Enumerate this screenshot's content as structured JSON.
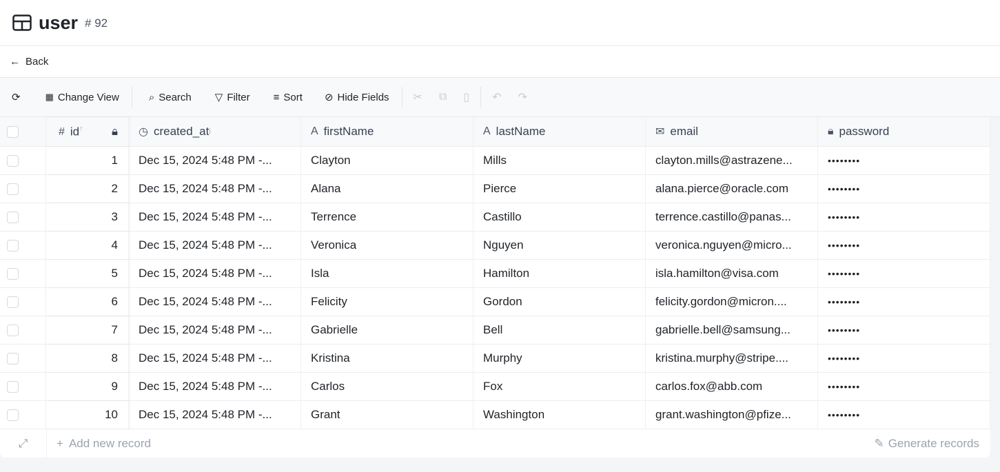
{
  "header": {
    "title": "user",
    "count": "# 92",
    "icon": "table-icon"
  },
  "back_label": "Back",
  "toolbar": {
    "change_view": "Change View",
    "search": "Search",
    "filter": "Filter",
    "sort": "Sort",
    "hide_fields": "Hide Fields"
  },
  "columns": [
    "id",
    "created_at",
    "firstName",
    "lastName",
    "email",
    "password"
  ],
  "rows": [
    {
      "id": "1",
      "created_at": "Dec 15, 2024 5:48 PM -...",
      "firstName": "Clayton",
      "lastName": "Mills",
      "email": "clayton.mills@astrazene...",
      "password": "••••••••"
    },
    {
      "id": "2",
      "created_at": "Dec 15, 2024 5:48 PM -...",
      "firstName": "Alana",
      "lastName": "Pierce",
      "email": "alana.pierce@oracle.com",
      "password": "••••••••"
    },
    {
      "id": "3",
      "created_at": "Dec 15, 2024 5:48 PM -...",
      "firstName": "Terrence",
      "lastName": "Castillo",
      "email": "terrence.castillo@panas...",
      "password": "••••••••"
    },
    {
      "id": "4",
      "created_at": "Dec 15, 2024 5:48 PM -...",
      "firstName": "Veronica",
      "lastName": "Nguyen",
      "email": "veronica.nguyen@micro...",
      "password": "••••••••"
    },
    {
      "id": "5",
      "created_at": "Dec 15, 2024 5:48 PM -...",
      "firstName": "Isla",
      "lastName": "Hamilton",
      "email": "isla.hamilton@visa.com",
      "password": "••••••••"
    },
    {
      "id": "6",
      "created_at": "Dec 15, 2024 5:48 PM -...",
      "firstName": "Felicity",
      "lastName": "Gordon",
      "email": "felicity.gordon@micron....",
      "password": "••••••••"
    },
    {
      "id": "7",
      "created_at": "Dec 15, 2024 5:48 PM -...",
      "firstName": "Gabrielle",
      "lastName": "Bell",
      "email": "gabrielle.bell@samsung...",
      "password": "••••••••"
    },
    {
      "id": "8",
      "created_at": "Dec 15, 2024 5:48 PM -...",
      "firstName": "Kristina",
      "lastName": "Murphy",
      "email": "kristina.murphy@stripe....",
      "password": "••••••••"
    },
    {
      "id": "9",
      "created_at": "Dec 15, 2024 5:48 PM -...",
      "firstName": "Carlos",
      "lastName": "Fox",
      "email": "carlos.fox@abb.com",
      "password": "••••••••"
    },
    {
      "id": "10",
      "created_at": "Dec 15, 2024 5:48 PM -...",
      "firstName": "Grant",
      "lastName": "Washington",
      "email": "grant.washington@pfize...",
      "password": "••••••••"
    }
  ],
  "footer": {
    "add": "Add new record",
    "generate": "Generate records"
  }
}
